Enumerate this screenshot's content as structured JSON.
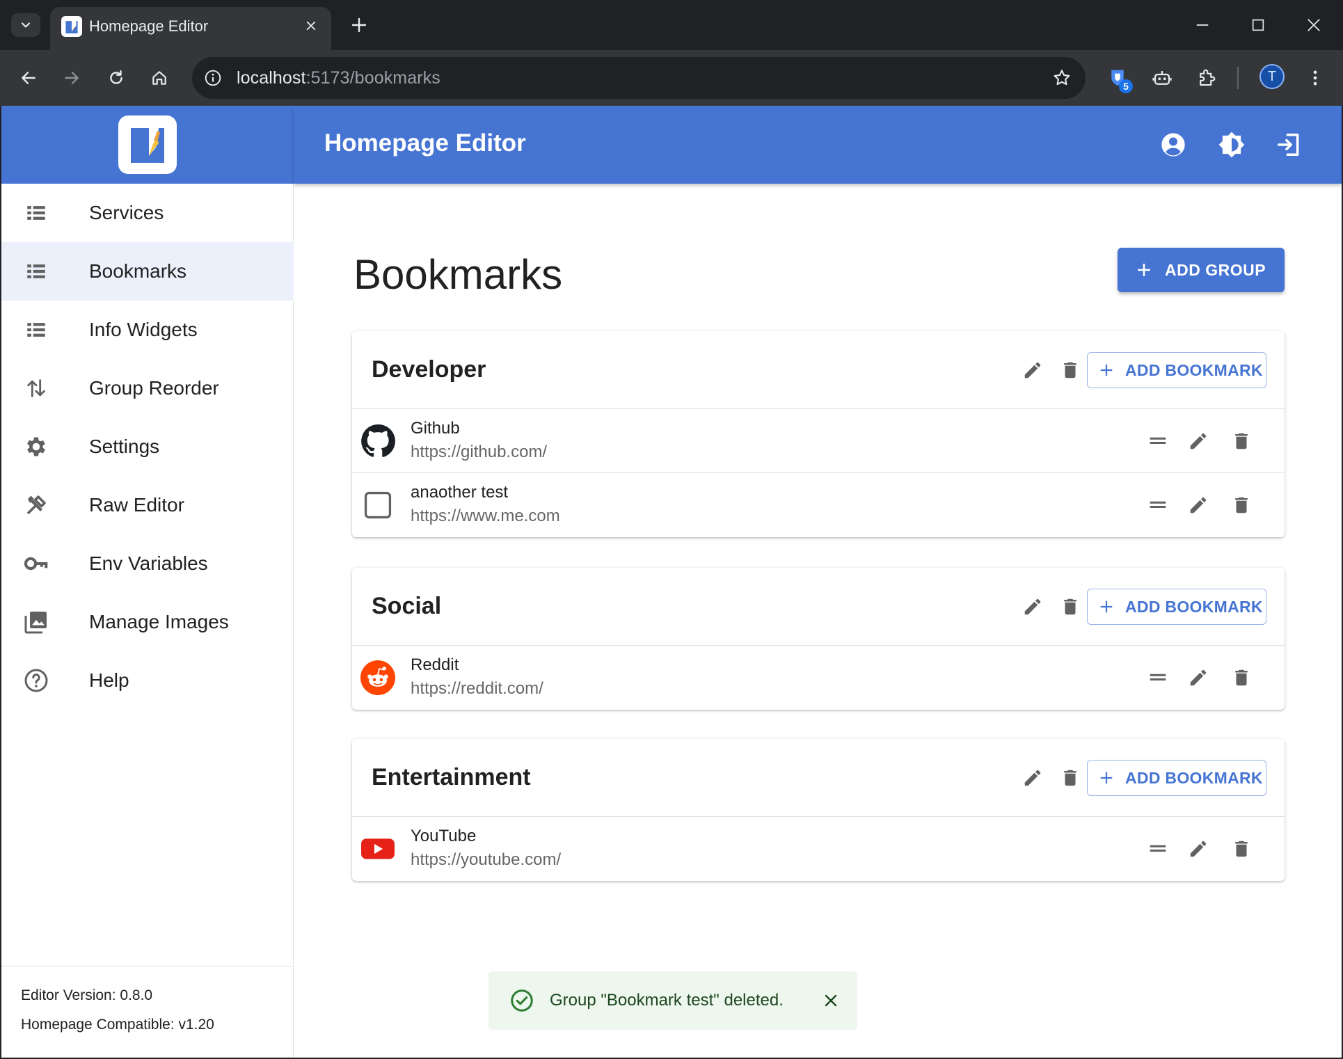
{
  "browser": {
    "tab_title": "Homepage Editor",
    "url_host": "localhost",
    "url_path": ":5173/bookmarks",
    "extension_badge": "5",
    "profile_initial": "T"
  },
  "app": {
    "title": "Homepage Editor",
    "accent_color": "#4674d3"
  },
  "sidebar": {
    "items": [
      {
        "label": "Services",
        "icon": "list-icon"
      },
      {
        "label": "Bookmarks",
        "icon": "list-icon",
        "active": true
      },
      {
        "label": "Info Widgets",
        "icon": "list-icon"
      },
      {
        "label": "Group Reorder",
        "icon": "swap-vertical-icon"
      },
      {
        "label": "Settings",
        "icon": "gear-icon"
      },
      {
        "label": "Raw Editor",
        "icon": "tools-icon"
      },
      {
        "label": "Env Variables",
        "icon": "key-icon"
      },
      {
        "label": "Manage Images",
        "icon": "images-icon"
      },
      {
        "label": "Help",
        "icon": "help-circle-icon"
      }
    ],
    "footer": {
      "version": "Editor Version: 0.8.0",
      "compat": "Homepage Compatible: v1.20"
    }
  },
  "page": {
    "title": "Bookmarks",
    "add_group_label": "ADD GROUP",
    "add_bookmark_label": "ADD BOOKMARK"
  },
  "groups": [
    {
      "name": "Developer",
      "bookmarks": [
        {
          "name": "Github",
          "url": "https://github.com/",
          "icon": "github-icon"
        },
        {
          "name": "anaother test",
          "url": "https://www.me.com",
          "icon": "placeholder-icon"
        }
      ]
    },
    {
      "name": "Social",
      "bookmarks": [
        {
          "name": "Reddit",
          "url": "https://reddit.com/",
          "icon": "reddit-icon"
        }
      ]
    },
    {
      "name": "Entertainment",
      "bookmarks": [
        {
          "name": "YouTube",
          "url": "https://youtube.com/",
          "icon": "youtube-icon"
        }
      ]
    }
  ],
  "snackbar": {
    "message": "Group \"Bookmark test\" deleted.",
    "status_color": "#2e7d32"
  }
}
